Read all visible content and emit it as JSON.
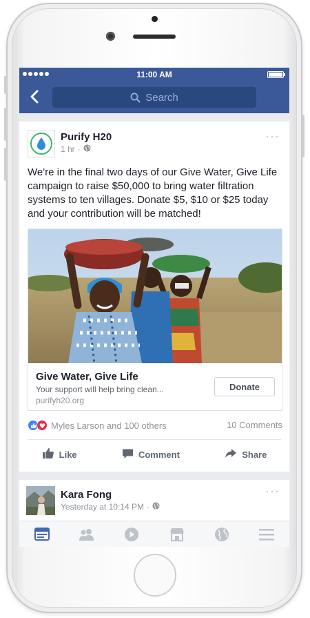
{
  "status_bar": {
    "time": "11:00 AM"
  },
  "nav": {
    "search_placeholder": "Search"
  },
  "post": {
    "author": "Purify H20",
    "time": "1 hr",
    "privacy_icon": "globe-icon",
    "text": "We're in the final two days of our Give Water, Give Life campaign to raise $50,000 to bring water filtration systems to ten villages. Donate $5, $10 or $25 today and your contribution will be matched!",
    "link": {
      "title": "Give Water, Give Life",
      "description": "Your support will help bring clean...",
      "domain": "purifyh20.org",
      "cta_label": "Donate"
    },
    "reactions": {
      "summary": "Myles Larson and 100 others",
      "comments": "10 Comments",
      "icons": [
        "like-reaction-icon",
        "love-reaction-icon"
      ]
    },
    "actions": {
      "like": "Like",
      "comment": "Comment",
      "share": "Share"
    }
  },
  "post2": {
    "author": "Kara Fong",
    "time": "Yesterday at 10:14 PM",
    "privacy_icon": "globe-icon"
  },
  "tab_bar": {
    "tabs": [
      "news-feed-icon",
      "friends-icon",
      "video-icon",
      "marketplace-icon",
      "notifications-globe-icon",
      "menu-icon"
    ],
    "active": "news-feed-icon"
  },
  "colors": {
    "brand": "#3b5998",
    "search_field": "#29487d",
    "feed_background": "#e9ebee",
    "like_blue": "#3b86f7",
    "love_red": "#f0284a",
    "page_logo_green": "#3fb56b",
    "page_logo_blue": "#2b8fd8"
  }
}
